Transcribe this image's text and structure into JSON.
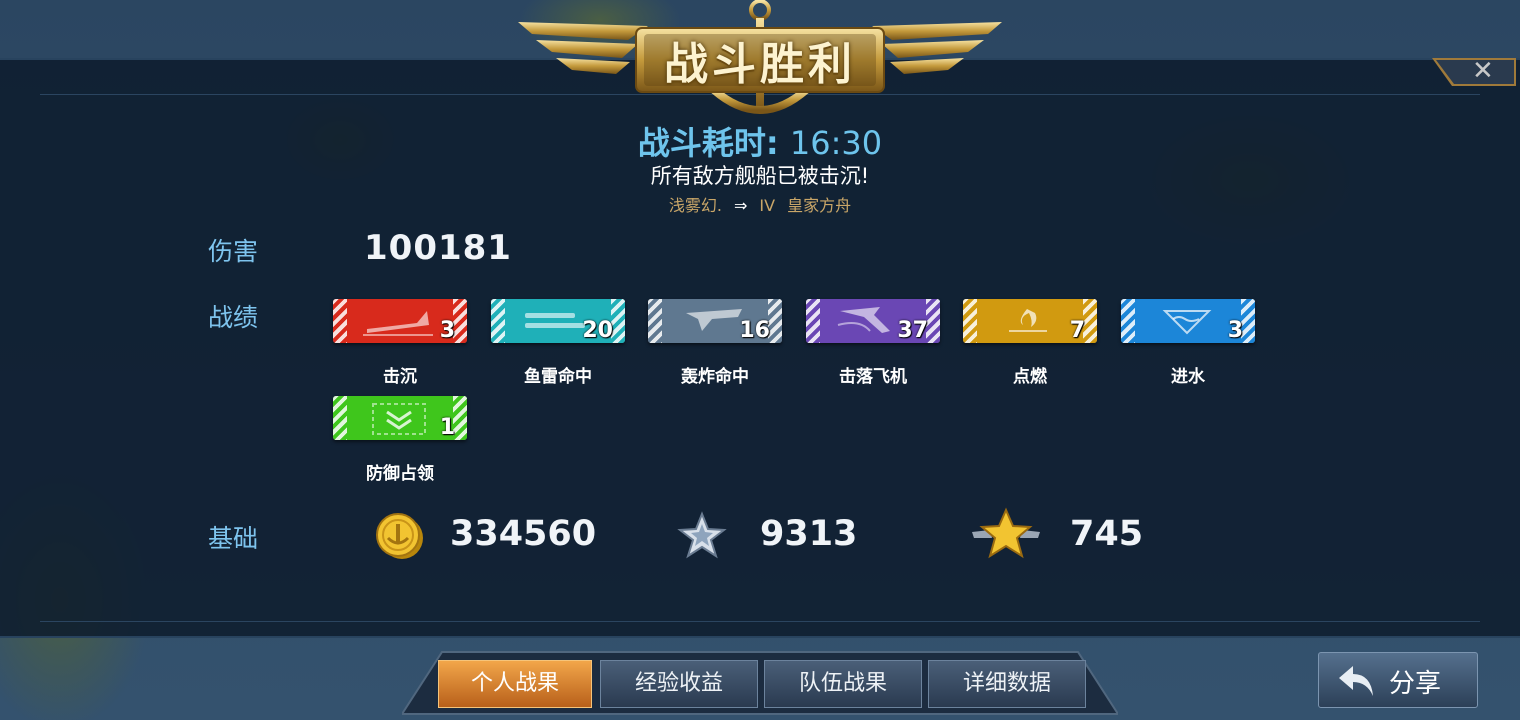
{
  "banner": {
    "title": "战斗胜利"
  },
  "battle": {
    "time_label": "战斗耗时: ",
    "time_value": "16:30",
    "result_text": "所有敌方舰船已被击沉!",
    "ship_left": "浅雾幻.",
    "ship_tier": "IV",
    "ship_right": "皇家方舟"
  },
  "damage": {
    "label": "伤害",
    "value": "100181"
  },
  "achievements": {
    "label": "战绩",
    "items": [
      {
        "name": "击沉",
        "count": "3",
        "color": "#d82a1c",
        "icon": "ship-sink-icon"
      },
      {
        "name": "鱼雷命中",
        "count": "20",
        "color": "#1fb0b8",
        "icon": "torpedo-icon"
      },
      {
        "name": "轰炸命中",
        "count": "16",
        "color": "#5f7890",
        "icon": "bomber-icon"
      },
      {
        "name": "击落飞机",
        "count": "37",
        "color": "#6a47b4",
        "icon": "plane-down-icon"
      },
      {
        "name": "点燃",
        "count": "7",
        "color": "#d19a10",
        "icon": "fire-icon"
      },
      {
        "name": "进水",
        "count": "3",
        "color": "#1c86d8",
        "icon": "flooding-icon"
      },
      {
        "name": "防御占领",
        "count": "1",
        "color": "#3fc61c",
        "icon": "defend-capture-icon"
      }
    ]
  },
  "base": {
    "label": "基础",
    "credits": "334560",
    "xp": "9313",
    "captain_xp": "745",
    "credit_icon": "anchor-coin-icon",
    "xp_icon": "silver-star-icon",
    "captain_icon": "gold-star-icon"
  },
  "tabs": [
    "个人战果",
    "经验收益",
    "队伍战果",
    "详细数据"
  ],
  "share_label": "分享"
}
